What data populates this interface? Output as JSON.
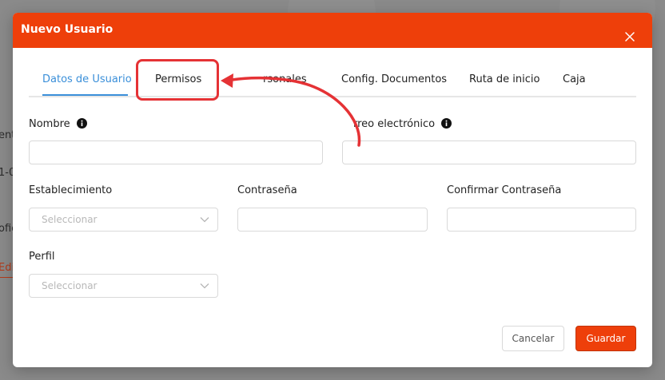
{
  "modal": {
    "title": "Nuevo Usuario"
  },
  "tabs": [
    {
      "label": "Datos de Usuario",
      "active": true
    },
    {
      "label": "Permisos",
      "active": false
    },
    {
      "label": "rsonales",
      "active": false
    },
    {
      "label": "Config. Documentos",
      "active": false
    },
    {
      "label": "Ruta de inicio",
      "active": false
    },
    {
      "label": "Caja",
      "active": false
    }
  ],
  "form": {
    "nombre_label": "Nombre",
    "correo_label": "rreo electrónico",
    "establecimiento_label": "Establecimiento",
    "establecimiento_placeholder": "Seleccionar",
    "contrasena_label": "Contraseña",
    "confirmar_label": "Confirmar Contraseña",
    "perfil_label": "Perfil",
    "perfil_placeholder": "Seleccionar"
  },
  "footer": {
    "cancel_label": "Cancelar",
    "save_label": "Guardar"
  },
  "background": {
    "fragments": [
      "ent",
      "1-0",
      "ofic",
      "Edi"
    ]
  },
  "colors": {
    "header": "#ee3f0a",
    "tab_active": "#3a8fd9",
    "annotation": "#e53235"
  }
}
